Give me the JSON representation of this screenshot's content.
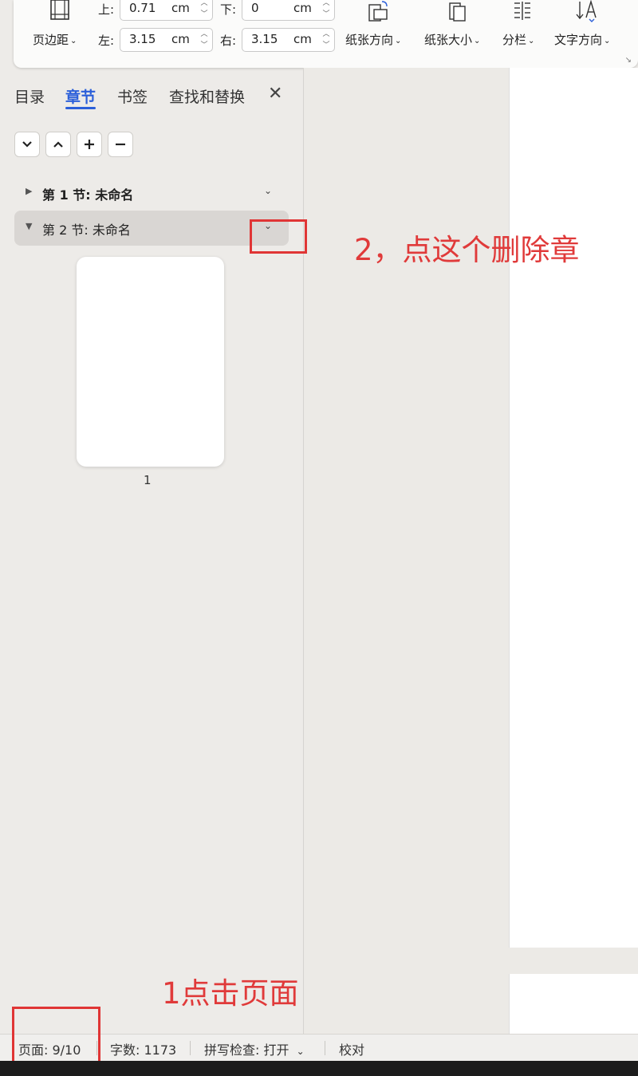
{
  "ribbon": {
    "margins_label": "页边距",
    "top_label": "上:",
    "top_value": "0.71",
    "bottom_label": "下:",
    "bottom_value": "0",
    "left_label": "左:",
    "left_value": "3.15",
    "right_label": "右:",
    "right_value": "3.15",
    "unit": "cm",
    "orientation_label": "纸张方向",
    "size_label": "纸张大小",
    "columns_label": "分栏",
    "text_direction_label": "文字方向",
    "launcher_glyph": "↘",
    "caret": "⌄",
    "spin_up": "︿",
    "spin_down": "﹀"
  },
  "nav_panel": {
    "tabs": [
      {
        "label": "目录",
        "active": false
      },
      {
        "label": "章节",
        "active": true
      },
      {
        "label": "书签",
        "active": false
      },
      {
        "label": "查找和替换",
        "active": false
      }
    ],
    "close_glyph": "✕",
    "tools": [
      "chevron-down-icon",
      "chevron-up-icon",
      "plus-icon",
      "minus-icon"
    ],
    "sections": [
      {
        "title": "第 1 节: 未命名",
        "expanded": false,
        "selected": false,
        "tri": "▶",
        "chev": "⌄"
      },
      {
        "title": "第 2 节: 未命名",
        "expanded": true,
        "selected": true,
        "tri": "▼",
        "chev": "⌄"
      }
    ],
    "thumbnail_page": "1"
  },
  "annotations": {
    "note_delete": "2，点这个删除章",
    "note_click_page": "1点击页面",
    "color": "#e03535"
  },
  "statusbar": {
    "page": "页面: 9/10",
    "words": "字数: 1173",
    "spellcheck": "拼写检查: 打开",
    "spellcheck_caret": "⌄",
    "proofread": "校对"
  },
  "colors": {
    "accent": "#2b5fd9",
    "annotation": "#e03535"
  }
}
